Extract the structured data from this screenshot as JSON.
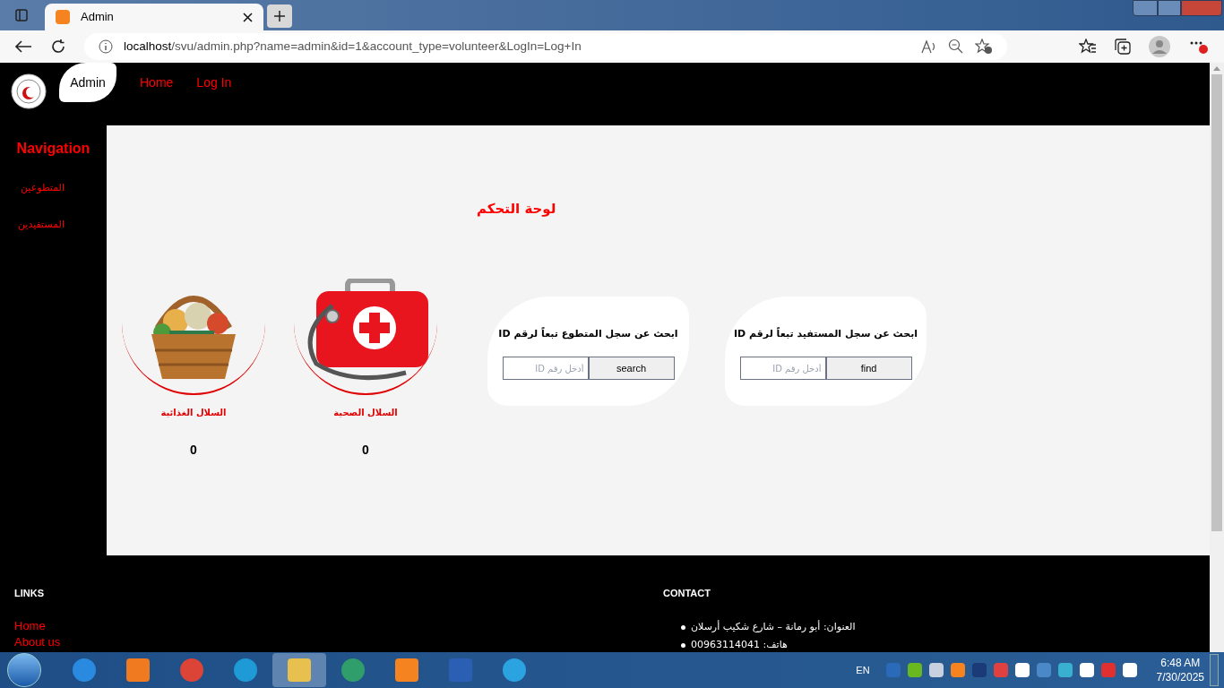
{
  "browser": {
    "tab_title": "Admin",
    "url_host": "localhost",
    "url_path": "/svu/admin.php?name=admin&id=1&account_type=volunteer&LogIn=Log+In"
  },
  "navbar": {
    "items": [
      {
        "label": "Log In",
        "selected": false
      },
      {
        "label": "Home",
        "selected": false
      },
      {
        "label": "Admin",
        "selected": true
      }
    ]
  },
  "sidebar": {
    "title": "Navigation",
    "items": [
      "المتطوعين",
      "المستفيدين"
    ]
  },
  "main": {
    "title": "لوحة التحكم",
    "search_cards": [
      {
        "title": "ابحث عن سجل المستفيد تبعاً لرقم ID",
        "placeholder": "أدخل رقم ID",
        "button": "find"
      },
      {
        "title": "ابحث عن سجل المتطوع تبعاً لرقم ID",
        "placeholder": "أدخل رقم ID",
        "button": "search"
      }
    ],
    "stats": [
      {
        "kind": "medkit",
        "label": "السلال الصحية",
        "count": "0"
      },
      {
        "kind": "basket",
        "label": "السلال الغذائية",
        "count": "0"
      }
    ]
  },
  "footer": {
    "links_title": "LINKS",
    "links": [
      "Home",
      "About us"
    ],
    "contact_title": "CONTACT",
    "contact": [
      "العنوان: أبو رمانة – شارع شكيب أرسلان",
      "هاتف: 00963114041"
    ]
  },
  "taskbar": {
    "language": "EN",
    "time": "6:48 AM",
    "date": "7/30/2025"
  }
}
